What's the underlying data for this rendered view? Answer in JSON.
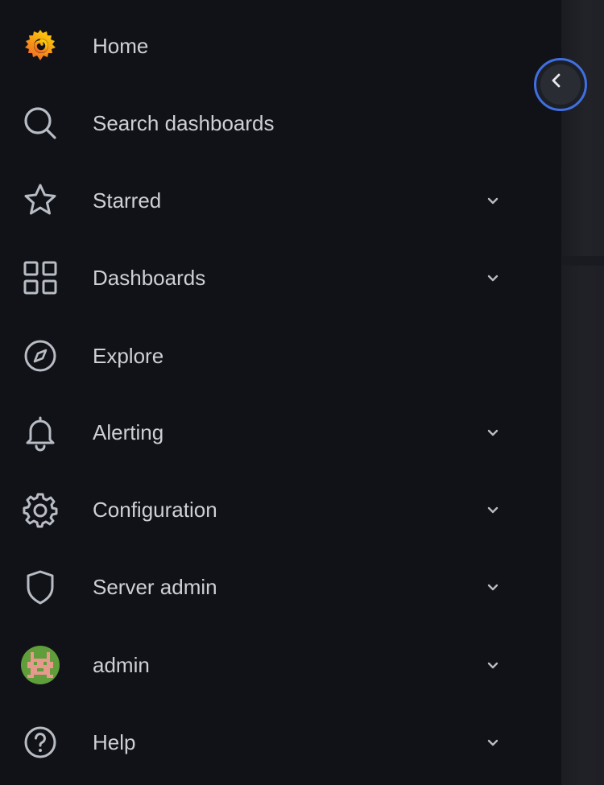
{
  "sidebar": {
    "items": [
      {
        "label": "Home",
        "icon": "grafana-logo-icon",
        "expandable": false
      },
      {
        "label": "Search dashboards",
        "icon": "search-icon",
        "expandable": false
      },
      {
        "label": "Starred",
        "icon": "star-icon",
        "expandable": true
      },
      {
        "label": "Dashboards",
        "icon": "apps-grid-icon",
        "expandable": true
      },
      {
        "label": "Explore",
        "icon": "compass-icon",
        "expandable": false
      },
      {
        "label": "Alerting",
        "icon": "bell-icon",
        "expandable": true
      },
      {
        "label": "Configuration",
        "icon": "gear-icon",
        "expandable": true
      },
      {
        "label": "Server admin",
        "icon": "shield-icon",
        "expandable": true
      },
      {
        "label": "admin",
        "icon": "avatar",
        "expandable": true
      },
      {
        "label": "Help",
        "icon": "question-circle-icon",
        "expandable": true
      }
    ],
    "collapse_button": {
      "icon": "chevron-left-icon"
    }
  },
  "colors": {
    "sidebar_bg": "#111217",
    "text": "#cdd0d6",
    "icon": "#b8bcc4",
    "focus_ring": "#3f6fe0",
    "logo_orange": "#f05a28",
    "logo_yellow": "#fbca0a"
  }
}
